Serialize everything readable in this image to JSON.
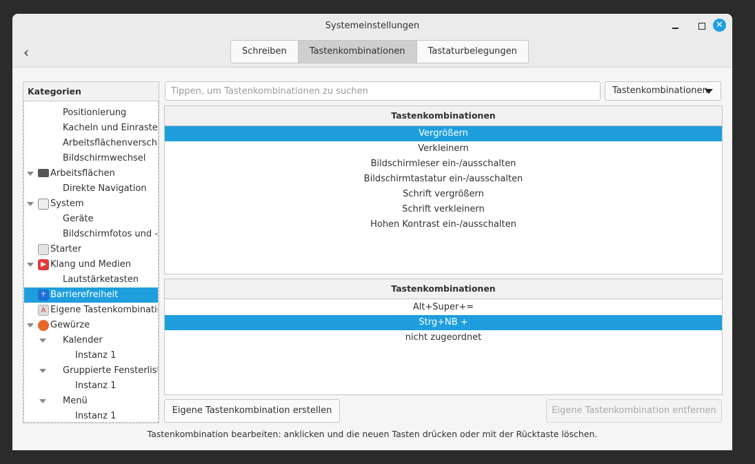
{
  "window": {
    "title": "Systemeinstellungen",
    "back_icon": "chevron-left-icon"
  },
  "tabs": [
    {
      "label": "Schreiben",
      "active": false
    },
    {
      "label": "Tastenkombinationen",
      "active": true
    },
    {
      "label": "Tastaturbelegungen",
      "active": false
    }
  ],
  "sidebar": {
    "header": "Kategorien",
    "items": [
      {
        "label": "Positionierung",
        "level": 2
      },
      {
        "label": "Kacheln und Einrasten",
        "level": 2
      },
      {
        "label": "Arbeitsflächenverschieb",
        "level": 2
      },
      {
        "label": "Bildschirmwechsel",
        "level": 2
      },
      {
        "label": "Arbeitsflächen",
        "level": 1,
        "expander": true,
        "icon": "monitor-icon"
      },
      {
        "label": "Direkte Navigation",
        "level": 2
      },
      {
        "label": "System",
        "level": 1,
        "expander": true,
        "icon": "system-icon"
      },
      {
        "label": "Geräte",
        "level": 2
      },
      {
        "label": "Bildschirmfotos und -au",
        "level": 2
      },
      {
        "label": "Starter",
        "level": 1,
        "icon": "launcher-icon"
      },
      {
        "label": "Klang und Medien",
        "level": 1,
        "expander": true,
        "icon": "media-play-icon"
      },
      {
        "label": "Lautstärketasten",
        "level": 2
      },
      {
        "label": "Barrierefreiheit",
        "level": 1,
        "icon": "accessibility-icon",
        "selected": true
      },
      {
        "label": "Eigene Tastenkombination",
        "level": 1,
        "icon": "custom-shortcut-icon"
      },
      {
        "label": "Gewürze",
        "level": 1,
        "expander": true,
        "icon": "cinnamon-icon"
      },
      {
        "label": "Kalender",
        "level": 2,
        "expander": true
      },
      {
        "label": "Instanz 1",
        "level": 3
      },
      {
        "label": "Gruppierte Fensterliste",
        "level": 2,
        "expander": true
      },
      {
        "label": "Instanz 1",
        "level": 3
      },
      {
        "label": "Menü",
        "level": 2,
        "expander": true
      },
      {
        "label": "Instanz 1",
        "level": 3
      }
    ]
  },
  "search": {
    "placeholder": "Tippen, um Tastenkombinationen zu suchen",
    "value": ""
  },
  "filter_dropdown": {
    "value": "Tastenkombinationen"
  },
  "shortcuts_table": {
    "header": "Tastenkombinationen",
    "rows": [
      "Vergrößern",
      "Verkleinern",
      "Bildschirmleser ein-/ausschalten",
      "Bildschirmtastatur ein-/ausschalten",
      "Schrift vergrößern",
      "Schrift verkleinern",
      "Hohen Kontrast ein-/ausschalten"
    ],
    "selected": 0
  },
  "bindings_table": {
    "header": "Tastenkombinationen",
    "rows": [
      "Alt+Super+=",
      "Strg+NB +",
      "nicht zugeordnet"
    ],
    "selected": 1
  },
  "buttons": {
    "add": "Eigene Tastenkombination erstellen",
    "remove": "Eigene Tastenkombination entfernen"
  },
  "status": "Tastenkombination bearbeiten: anklicken und die neuen Tasten drücken oder mit der Rücktaste löschen.",
  "colors": {
    "accent": "#1e9edc",
    "close": "#1f9ee0"
  }
}
